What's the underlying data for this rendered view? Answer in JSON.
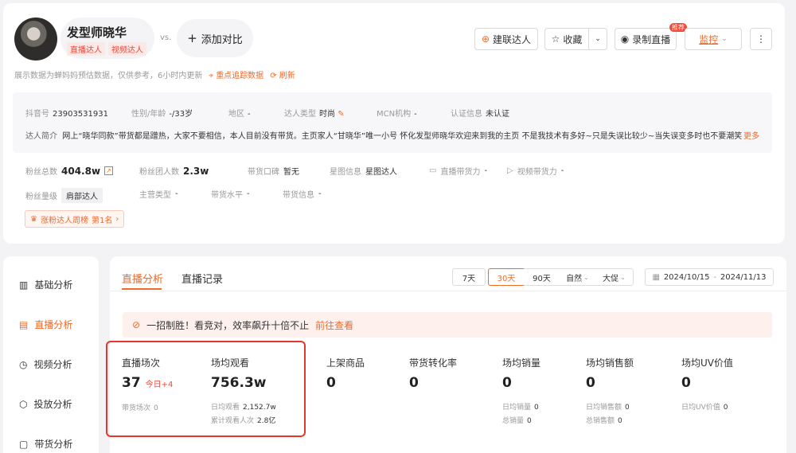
{
  "profile": {
    "name": "发型师晓华",
    "tags": [
      "直播达人",
      "视频达人"
    ],
    "vs": "vs.",
    "compare_label": "添加对比",
    "note": "展示数据为蝉妈妈预估数据，仅供参考，6小时内更新",
    "track_label": "重点追踪数据",
    "refresh_label": "刷新"
  },
  "actions": {
    "build_link": "建联达人",
    "favorite": "收藏",
    "record_live": "录制直播",
    "new_badge": "推荐",
    "monitor": "监控"
  },
  "info": {
    "douyin_label": "抖音号",
    "douyin_value": "23903531931",
    "gender_label": "性别/年龄",
    "gender_value": "-/33岁",
    "region_label": "地区",
    "region_value": "-",
    "type_label": "达人类型",
    "type_value": "时尚",
    "mcn_label": "MCN机构",
    "mcn_value": "-",
    "cert_label": "认证信息",
    "cert_value": "未认证",
    "intro_label": "达人简介",
    "intro_text": "网上“晓华同款”带货都是蹭热，大家不要相信，本人目前没有带货。主页家人“甘晓华”唯一小号 怀化发型师晓华欢迎来到我的主页 不是我技术有多好~只是失误比较少~当失误变多时也不要潮笑",
    "more": "更多"
  },
  "stats": {
    "fans_label": "粉丝总数",
    "fans_value": "404.8w",
    "group_label": "粉丝团人数",
    "group_value": "2.3w",
    "reputation_label": "带货口碑",
    "reputation_value": "暂无",
    "star_label": "星图信息",
    "star_value": "星图达人",
    "live_power_label": "直播带货力",
    "live_power_value": "-",
    "video_power_label": "视频带货力",
    "video_power_value": "-",
    "level_label": "粉丝量级",
    "level_value": "肩部达人",
    "category_label": "主营类型",
    "category_value": "-",
    "sales_level_label": "带货水平",
    "sales_level_value": "-",
    "sales_info_label": "带货信息",
    "sales_info_value": "-",
    "rank_label": "涨粉达人周榜",
    "rank_value": "第1名"
  },
  "sidebar": {
    "items": [
      {
        "label": "基础分析",
        "icon": "chart-icon"
      },
      {
        "label": "直播分析",
        "icon": "live-icon"
      },
      {
        "label": "视频分析",
        "icon": "play-icon"
      },
      {
        "label": "投放分析",
        "icon": "cube-icon"
      },
      {
        "label": "带货分析",
        "icon": "bag-icon"
      }
    ]
  },
  "tabs": [
    "直播分析",
    "直播记录"
  ],
  "ranges": [
    "7天",
    "30天",
    "90天",
    "自然",
    "大促"
  ],
  "date_range": {
    "start": "2024/10/15",
    "sep": "-",
    "end": "2024/11/13"
  },
  "promo": {
    "text": "一招制胜！看竞对，效率飙升十倍不止",
    "link": "前往查看"
  },
  "metrics": {
    "live_count": {
      "label": "直播场次",
      "value": "37",
      "today": "今日+4",
      "sub_label": "带货场次",
      "sub_value": "0"
    },
    "avg_watch": {
      "label": "场均观看",
      "value": "756.3w",
      "daily_label": "日均观看",
      "daily_value": "2,152.7w",
      "total_label": "累计观看人次",
      "total_value": "2.8亿"
    },
    "goods": {
      "label": "上架商品",
      "value": "0"
    },
    "conversion": {
      "label": "带货转化率",
      "value": "0"
    },
    "avg_sales": {
      "label": "场均销量",
      "value": "0",
      "daily_label": "日均销量",
      "daily_value": "0",
      "total_label": "总销量",
      "total_value": "0"
    },
    "avg_amount": {
      "label": "场均销售额",
      "value": "0",
      "daily_label": "日均销售额",
      "daily_value": "0",
      "total_label": "总销售额",
      "total_value": "0"
    },
    "uv": {
      "label": "场均UV价值",
      "value": "0",
      "daily_label": "日均UV价值",
      "daily_value": "0"
    }
  }
}
